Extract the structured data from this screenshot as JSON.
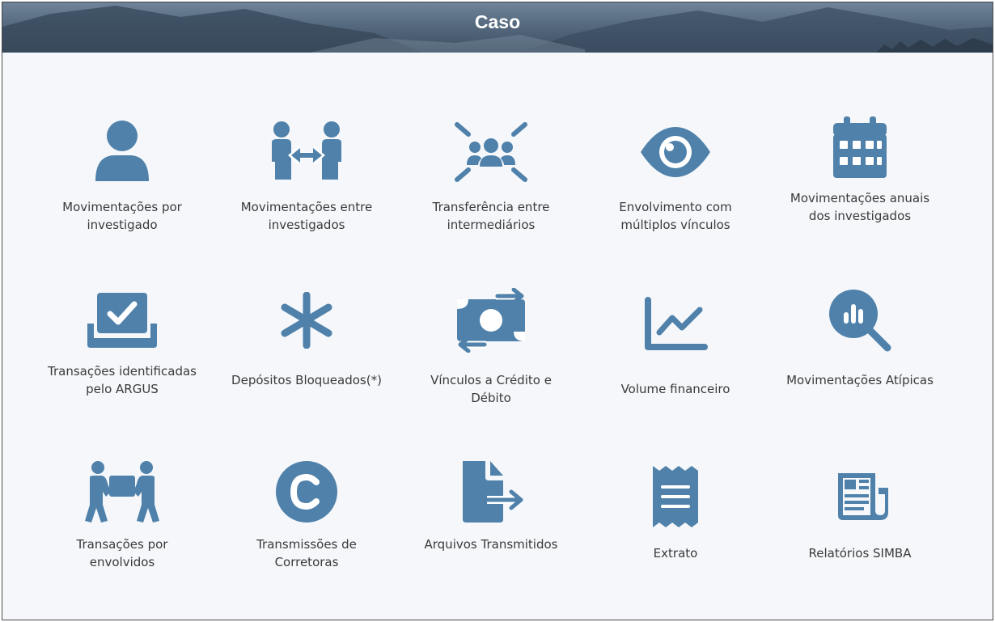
{
  "header": {
    "title": "Caso"
  },
  "colors": {
    "icon": "#4f81aa",
    "text": "#3a3a3a",
    "background": "#f5f7fa"
  },
  "tiles": [
    {
      "label": "Movimentações por investigado",
      "icon": "user-icon"
    },
    {
      "label": "Movimentações entre investigados",
      "icon": "people-arrows-icon"
    },
    {
      "label": "Transferência entre intermediários",
      "icon": "group-burst-icon"
    },
    {
      "label": "Envolvimento com múltiplos vínculos",
      "icon": "eye-icon"
    },
    {
      "label": "Movimentações anuais dos investigados",
      "icon": "calendar-icon"
    },
    {
      "label": "Transações identificadas pelo ARGUS",
      "icon": "inbox-check-icon"
    },
    {
      "label": "Depósitos Bloqueados(*)",
      "icon": "asterisk-icon"
    },
    {
      "label": "Vínculos a Crédito e Débito",
      "icon": "money-transfer-icon"
    },
    {
      "label": "Volume financeiro",
      "icon": "line-chart-icon"
    },
    {
      "label": "Movimentações Atípicas",
      "icon": "magnify-chart-icon"
    },
    {
      "label": "Transações por envolvidos",
      "icon": "people-carry-box-icon"
    },
    {
      "label": "Transmissões de Corretoras",
      "icon": "copyright-circle-icon"
    },
    {
      "label": "Arquivos Transmitidos",
      "icon": "file-export-icon"
    },
    {
      "label": "Extrato",
      "icon": "receipt-icon"
    },
    {
      "label": "Relatórios SIMBA",
      "icon": "newspaper-icon"
    }
  ]
}
